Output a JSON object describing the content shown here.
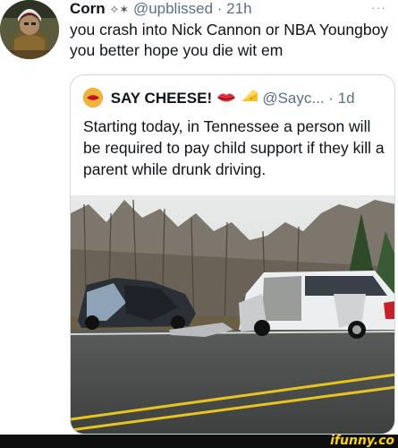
{
  "tweet": {
    "avatar_icon": "user-avatar",
    "display_name": "Corn",
    "name_icons": "✧✶",
    "handle": "@upblissed",
    "separator": "·",
    "time": "21h",
    "more_icon": "more-icon",
    "more_glyph": "···",
    "text": "you crash into Nick Cannon or NBA Youngboy you better hope you die wit em"
  },
  "quote": {
    "avatar_icon": "lips-icon",
    "display_name": "SAY CHEESE!",
    "name_icons": [
      "lips-icon",
      "cheese-icon"
    ],
    "handle": "@Sayc...",
    "separator": "·",
    "time": "1d",
    "text": "Starting today, in Tennessee a person will be required to pay child support if they kill a parent while drunk driving.",
    "media": "car-crash-photo"
  },
  "watermark": {
    "logo": "ifunny.co",
    "color": "#f6d21a"
  }
}
